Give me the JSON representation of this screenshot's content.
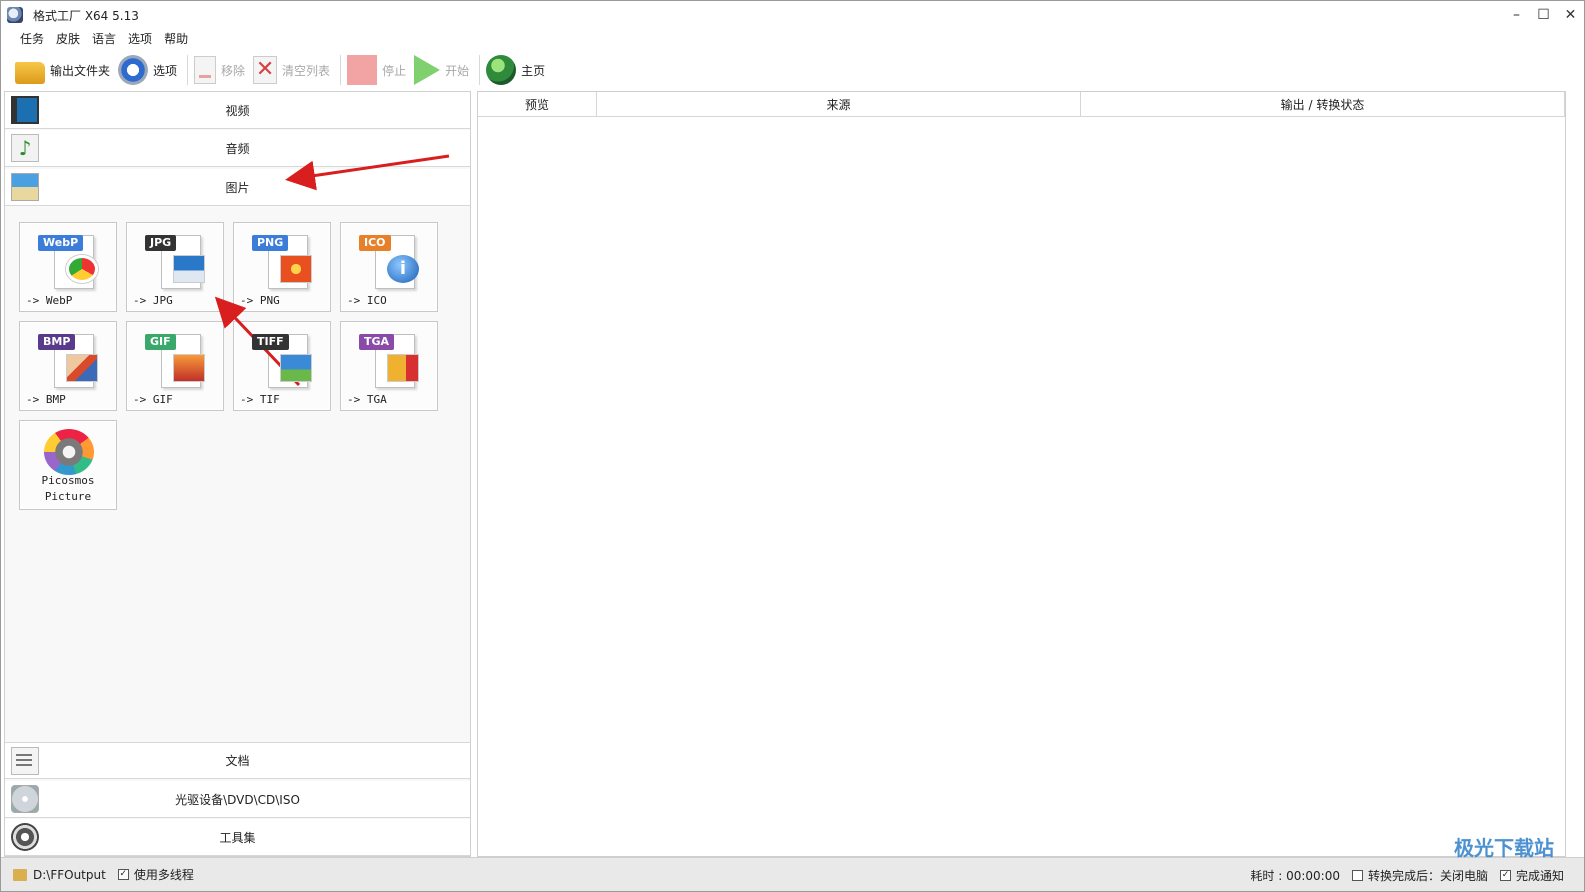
{
  "window": {
    "title": "格式工厂 X64 5.13",
    "minimize": "–",
    "maximize": "☐",
    "close": "✕"
  },
  "menu": [
    "任务",
    "皮肤",
    "语言",
    "选项",
    "帮助"
  ],
  "toolbar": {
    "output_folder": "输出文件夹",
    "options": "选项",
    "remove": "移除",
    "clear_list": "清空列表",
    "stop": "停止",
    "start": "开始",
    "home": "主页"
  },
  "categories": {
    "video": "视频",
    "audio": "音频",
    "image": "图片",
    "document": "文档",
    "disc": "光驱设备\\DVD\\CD\\ISO",
    "tools": "工具集"
  },
  "image_formats": [
    {
      "badge": "WebP",
      "label": "-> WebP",
      "color": "#3b7dd8"
    },
    {
      "badge": "JPG",
      "label": "-> JPG",
      "color": "#333333"
    },
    {
      "badge": "PNG",
      "label": "-> PNG",
      "color": "#3b7dd8"
    },
    {
      "badge": "ICO",
      "label": "-> ICO",
      "color": "#e8802a"
    },
    {
      "badge": "BMP",
      "label": "-> BMP",
      "color": "#5a3a8a"
    },
    {
      "badge": "GIF",
      "label": "-> GIF",
      "color": "#3aa86a"
    },
    {
      "badge": "TIFF",
      "label": "-> TIF",
      "color": "#333333"
    },
    {
      "badge": "TGA",
      "label": "-> TGA",
      "color": "#8a4aa8"
    }
  ],
  "picosmos": {
    "line1": "Picosmos",
    "line2": "Picture"
  },
  "table": {
    "columns": [
      "预览",
      "来源",
      "输出 / 转换状态"
    ]
  },
  "statusbar": {
    "output_path": "D:\\FFOutput",
    "multithread": "使用多线程",
    "elapsed": "耗时 : 00:00:00",
    "after_convert": "转换完成后：关闭电脑",
    "notify": "完成通知"
  },
  "watermark": "极光下载站",
  "colors": {
    "arrow": "#d81e1e"
  }
}
